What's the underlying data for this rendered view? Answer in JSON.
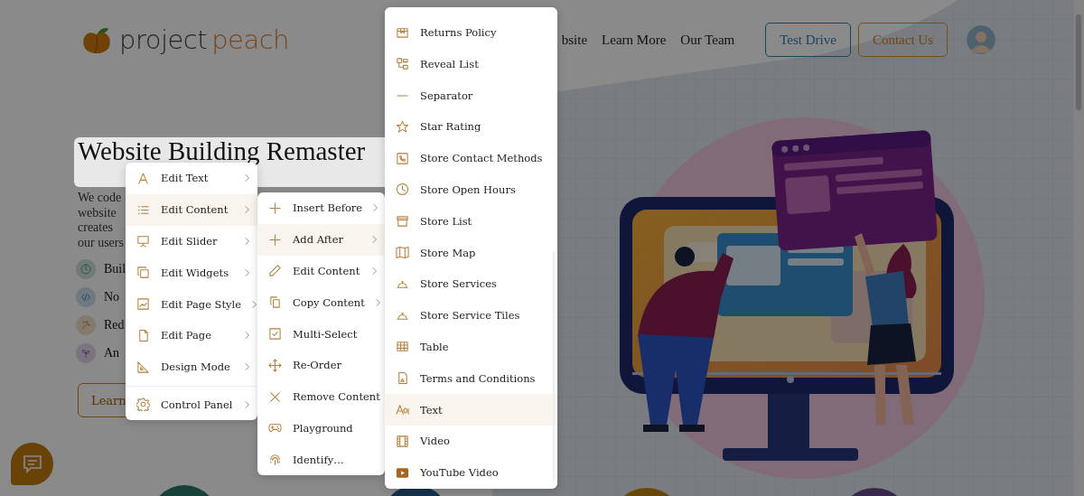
{
  "header": {
    "logo": {
      "word_1": "project",
      "word_2": "peach"
    },
    "nav": [
      {
        "label": "bsite"
      },
      {
        "label": "Learn More"
      },
      {
        "label": "Our Team"
      }
    ],
    "buttons": [
      {
        "label": "Test Drive",
        "kind": "secondary"
      },
      {
        "label": "Contact Us",
        "kind": "primary"
      }
    ]
  },
  "hero": {
    "heading": "Website Building Remaster",
    "paragraph_lines": [
      "We code",
      "website",
      "creates",
      "our users"
    ],
    "features": [
      {
        "text": "Buil"
      },
      {
        "text": "No"
      },
      {
        "text": "Red"
      },
      {
        "text": "An"
      }
    ],
    "button": "Learn"
  },
  "context_menus": [
    {
      "sections": [
        {
          "items": [
            {
              "label": "Edit Text",
              "submenu": true,
              "selected": false
            },
            {
              "label": "Edit Content",
              "submenu": true,
              "selected": true
            },
            {
              "label": "Edit Slider",
              "submenu": true,
              "selected": false
            },
            {
              "label": "Edit Widgets",
              "submenu": true,
              "selected": false
            },
            {
              "label": "Edit Page Style",
              "submenu": true,
              "selected": false
            },
            {
              "label": "Edit Page",
              "submenu": true,
              "selected": false
            },
            {
              "label": "Design Mode",
              "submenu": true,
              "selected": false
            }
          ]
        },
        {
          "items": [
            {
              "label": "Control Panel",
              "submenu": true,
              "selected": false
            }
          ]
        }
      ]
    },
    {
      "sections": [
        {
          "items": [
            {
              "label": "Insert Before",
              "submenu": true,
              "selected": false
            },
            {
              "label": "Add After",
              "submenu": true,
              "selected": true
            },
            {
              "label": "Edit Content",
              "submenu": true,
              "selected": false
            },
            {
              "label": "Copy Content",
              "submenu": true,
              "selected": false
            },
            {
              "label": "Multi-Select",
              "submenu": false,
              "selected": false
            },
            {
              "label": "Re-Order",
              "submenu": false,
              "selected": false
            },
            {
              "label": "Remove Content",
              "submenu": false,
              "selected": false
            },
            {
              "label": "Playground",
              "submenu": false,
              "selected": false
            },
            {
              "label": "Identify…",
              "submenu": false,
              "selected": false
            }
          ]
        }
      ]
    },
    {
      "sections": [
        {
          "items": [
            {
              "label": "Returns Policy",
              "submenu": false,
              "selected": false
            },
            {
              "label": "Reveal List",
              "submenu": false,
              "selected": false
            },
            {
              "label": "Separator",
              "submenu": false,
              "selected": false
            },
            {
              "label": "Star Rating",
              "submenu": false,
              "selected": false
            },
            {
              "label": "Store Contact Methods",
              "submenu": false,
              "selected": false
            },
            {
              "label": "Store Open Hours",
              "submenu": false,
              "selected": false
            },
            {
              "label": "Store List",
              "submenu": false,
              "selected": false
            },
            {
              "label": "Store Map",
              "submenu": false,
              "selected": false
            },
            {
              "label": "Store Services",
              "submenu": false,
              "selected": false
            },
            {
              "label": "Store Service Tiles",
              "submenu": false,
              "selected": false
            },
            {
              "label": "Table",
              "submenu": false,
              "selected": false
            },
            {
              "label": "Terms and Conditions",
              "submenu": false,
              "selected": false
            },
            {
              "label": "Text",
              "submenu": false,
              "selected": true
            },
            {
              "label": "Video",
              "submenu": false,
              "selected": false
            },
            {
              "label": "YouTube Video",
              "submenu": false,
              "selected": false
            }
          ]
        }
      ]
    }
  ]
}
